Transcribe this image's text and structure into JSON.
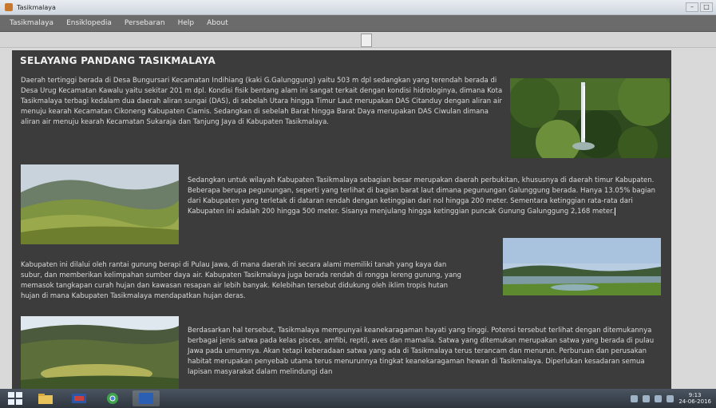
{
  "window": {
    "title": "Tasikmalaya",
    "minimize": "–",
    "maximize": "□"
  },
  "menu": [
    {
      "label": "Tasikmalaya"
    },
    {
      "label": "Ensiklopedia"
    },
    {
      "label": "Persebaran"
    },
    {
      "label": "Help"
    },
    {
      "label": "About"
    }
  ],
  "article": {
    "title": "SELAYANG PANDANG TASIKMALAYA",
    "p1": "Daerah tertinggi berada di Desa Bungursari Kecamatan Indihiang (kaki G.Galunggung) yaitu 503 m dpl sedangkan yang terendah berada di Desa Urug Kecamatan Kawalu yaitu sekitar 201 m dpl. Kondisi fisik bentang alam ini sangat terkait dengan kondisi hidrologinya, dimana Kota Tasikmalaya terbagi kedalam dua daerah aliran sungai (DAS), di sebelah Utara hingga Timur Laut merupakan DAS Citanduy dengan aliran air menuju kearah Kecamatan Cikoneng Kabupaten Ciamis. Sedangkan di sebelah Barat hingga Barat Daya merupakan DAS Ciwulan dimana aliran air menuju kearah Kecamatan Sukaraja dan Tanjung Jaya di Kabupaten Tasikmalaya.",
    "p2": "Sedangkan untuk wilayah Kabupaten Tasikmalaya sebagian besar merupakan daerah perbukitan, khususnya di daerah timur Kabupaten. Beberapa berupa pegunungan, seperti yang terlihat di bagian barat laut dimana pegunungan Galunggung berada. Hanya 13.05% bagian dari Kabupaten yang terletak di dataran rendah dengan ketinggian dari nol hingga 200 meter. Sementara ketinggian rata-rata dari Kabupaten ini adalah 200 hingga 500 meter. Sisanya menjulang hingga ketinggian puncak Gunung Galunggung 2,168 meter.",
    "p3": "Kabupaten ini dilalui oleh rantai gunung berapi di Pulau Jawa, di mana daerah ini secara alami memiliki tanah yang kaya dan subur, dan memberikan kelimpahan sumber daya air. Kabupaten Tasikmalaya juga berada rendah di rongga lereng gunung, yang memasok tangkapan curah hujan dan kawasan resapan air lebih banyak. Kelebihan tersebut didukung oleh iklim tropis hutan hujan di mana Kabupaten Tasikmalaya mendapatkan hujan deras.",
    "p4": "Berdasarkan hal tersebut, Tasikmalaya mempunyai keanekaragaman hayati yang tinggi. Potensi tersebut terlihat dengan ditemukannya berbagai jenis satwa pada kelas pisces, amfibi, reptil, aves dan mamalia. Satwa yang ditemukan merupakan satwa yang berada di pulau Jawa pada umumnya. Akan tetapi keberadaan satwa yang ada di Tasikmalaya terus terancam dan menurun. Perburuan dan perusakan habitat merupakan penyebab utama terus menurunnya tingkat keanekaragaman hewan di Tasikmalaya. Diperlukan kesadaran semua lapisan masyarakat dalam melindungi dan"
  },
  "taskbar": {
    "clock_time": "9:13",
    "clock_date": "24-06-2016",
    "word_label": "W"
  }
}
